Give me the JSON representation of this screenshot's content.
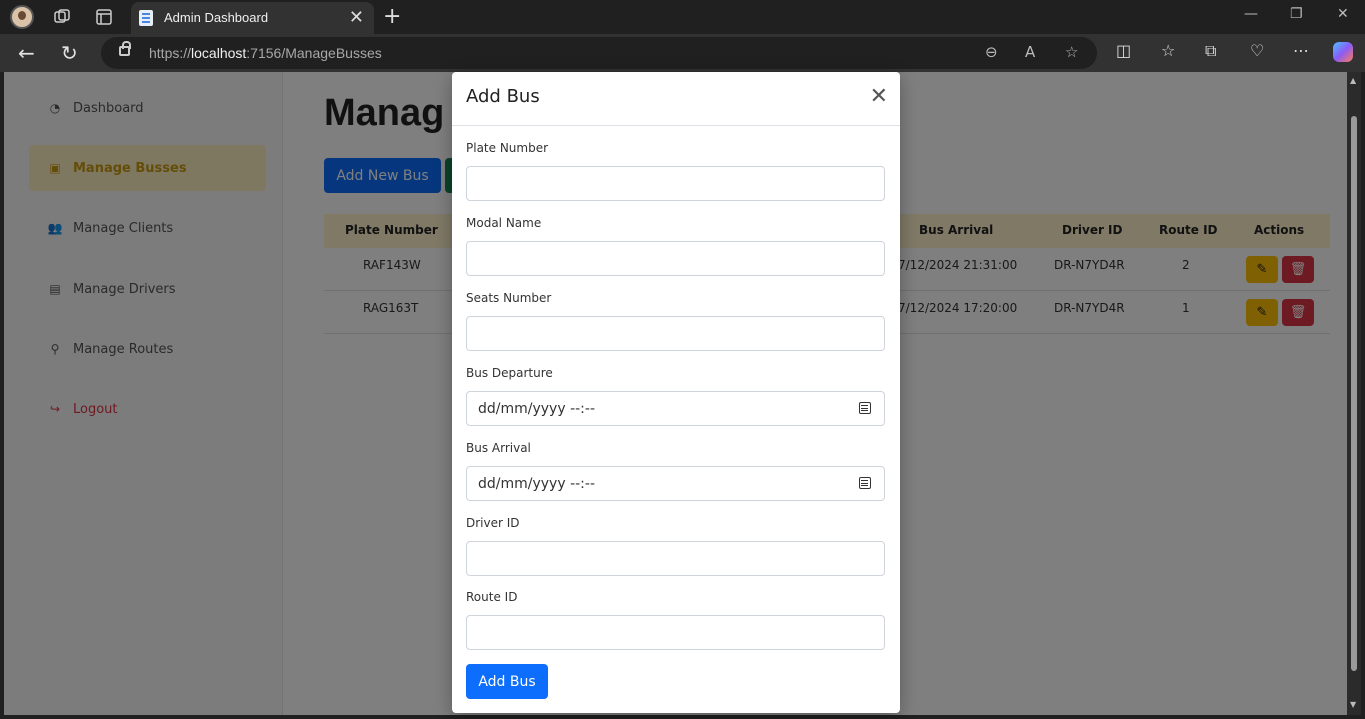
{
  "browser": {
    "tab_title": "Admin Dashboard",
    "tab_close": "✕",
    "new_tab": "+",
    "url_prefix": "https://",
    "url_host": "localhost",
    "url_path": ":7156/ManageBusses"
  },
  "sidebar": {
    "items": [
      {
        "label": "Dashboard",
        "icon": "gauge-icon",
        "glyph": "◔"
      },
      {
        "label": "Manage Busses",
        "icon": "bus-icon",
        "glyph": "▣"
      },
      {
        "label": "Manage Clients",
        "icon": "users-icon",
        "glyph": "👥"
      },
      {
        "label": "Manage Drivers",
        "icon": "id-card-icon",
        "glyph": "▤"
      },
      {
        "label": "Manage Routes",
        "icon": "route-icon",
        "glyph": "⚲"
      },
      {
        "label": "Logout",
        "icon": "logout-icon",
        "glyph": "↪"
      }
    ]
  },
  "main": {
    "title": "Manag",
    "add_button": "Add New Bus",
    "columns": [
      "Plate Number",
      "Bus Arrival",
      "Driver ID",
      "Route ID",
      "Actions"
    ],
    "rows": [
      {
        "plate": "RAF143W",
        "arrival": "7/12/2024 21:31:00",
        "driver": "DR-N7YD4R",
        "route": "2"
      },
      {
        "plate": "RAG163T",
        "arrival": "7/12/2024 17:20:00",
        "driver": "DR-N7YD4R",
        "route": "1"
      }
    ]
  },
  "modal": {
    "title": "Add Bus",
    "fields": [
      {
        "label": "Plate Number",
        "value": ""
      },
      {
        "label": "Modal Name",
        "value": ""
      },
      {
        "label": "Seats Number",
        "value": ""
      },
      {
        "label": "Bus Departure",
        "value": "dd/mm/yyyy --:--"
      },
      {
        "label": "Bus Arrival",
        "value": "dd/mm/yyyy --:--"
      },
      {
        "label": "Driver ID",
        "value": ""
      },
      {
        "label": "Route ID",
        "value": ""
      }
    ],
    "submit": "Add Bus"
  },
  "colors": {
    "primary": "#0d6efd",
    "warning": "#ffc107",
    "danger": "#dc3545",
    "active_bg": "#fff0c2"
  }
}
